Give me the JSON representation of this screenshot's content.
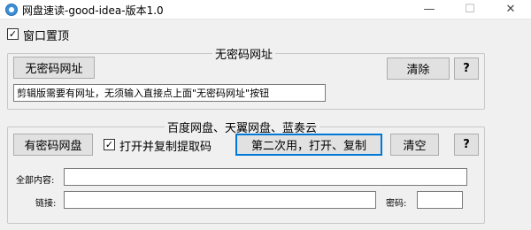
{
  "window": {
    "title": "网盘速读-good-idea-版本1.0",
    "minimize": "—",
    "maximize": "☐",
    "close": "✕"
  },
  "topmost": {
    "label": "窗口置顶",
    "checked": true,
    "mark": "✓"
  },
  "group1": {
    "legend": "无密码网址",
    "no_pwd_button": "无密码网址",
    "clear_button": "清除",
    "help_button": "?",
    "hint_value": "剪辑版需要有网址，无须输入直接点上面\"无密码网址\"按钮"
  },
  "group2": {
    "legend": "百度网盘、天翼网盘、蓝奏云",
    "pwd_button": "有密码网盘",
    "open_copy": {
      "label": "打开并复制提取码",
      "checked": true,
      "mark": "✓"
    },
    "second_use_button": "第二次用，打开、复制",
    "clear_button": "清空",
    "help_button": "?",
    "all_content_label": "全部内容:",
    "all_content_value": "",
    "link_label": "链接:",
    "link_value": "",
    "password_label": "密码:",
    "password_value": ""
  }
}
